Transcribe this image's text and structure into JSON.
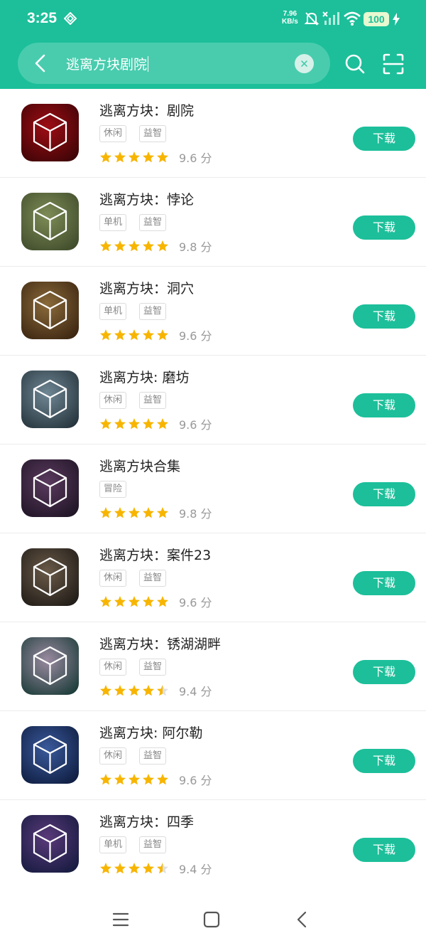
{
  "status": {
    "time": "3:25",
    "net_speed_value": "7.96",
    "net_speed_unit": "KB/s",
    "battery": "100",
    "icons": [
      "diamond-icon",
      "bell-off-icon",
      "signal-off-icon",
      "wifi-icon",
      "battery-icon",
      "charging-bolt-icon"
    ]
  },
  "header": {
    "search_value": "逃离方块剧院",
    "icons": [
      "back-arrow-icon",
      "clear-x-icon",
      "search-icon",
      "scan-icon"
    ]
  },
  "colors": {
    "brand": "#1cbf9a",
    "star": "#f7b500",
    "star_empty": "#e0e0e0"
  },
  "results": [
    {
      "title": "逃离方块：剧院",
      "tags": [
        "休闲",
        "益智"
      ],
      "stars": 5,
      "score": "9.6 分",
      "button": "下载"
    },
    {
      "title": "逃离方块：悖论",
      "tags": [
        "单机",
        "益智"
      ],
      "stars": 5,
      "score": "9.8 分",
      "button": "下载"
    },
    {
      "title": "逃离方块：洞穴",
      "tags": [
        "单机",
        "益智"
      ],
      "stars": 5,
      "score": "9.6 分",
      "button": "下载"
    },
    {
      "title": "逃离方块: 磨坊",
      "tags": [
        "休闲",
        "益智"
      ],
      "stars": 5,
      "score": "9.6 分",
      "button": "下载"
    },
    {
      "title": "逃离方块合集",
      "tags": [
        "冒险"
      ],
      "stars": 5,
      "score": "9.8 分",
      "button": "下载"
    },
    {
      "title": "逃离方块：案件23",
      "tags": [
        "休闲",
        "益智"
      ],
      "stars": 5,
      "score": "9.6 分",
      "button": "下载"
    },
    {
      "title": "逃离方块：锈湖湖畔",
      "tags": [
        "休闲",
        "益智"
      ],
      "stars": 4.5,
      "score": "9.4 分",
      "button": "下载"
    },
    {
      "title": "逃离方块: 阿尔勒",
      "tags": [
        "休闲",
        "益智"
      ],
      "stars": 5,
      "score": "9.6 分",
      "button": "下载"
    },
    {
      "title": "逃离方块：四季",
      "tags": [
        "单机",
        "益智"
      ],
      "stars": 4.5,
      "score": "9.4 分",
      "button": "下载"
    }
  ],
  "navbar": {
    "icons": [
      "menu-icon",
      "home-square-icon",
      "back-chevron-icon"
    ]
  }
}
